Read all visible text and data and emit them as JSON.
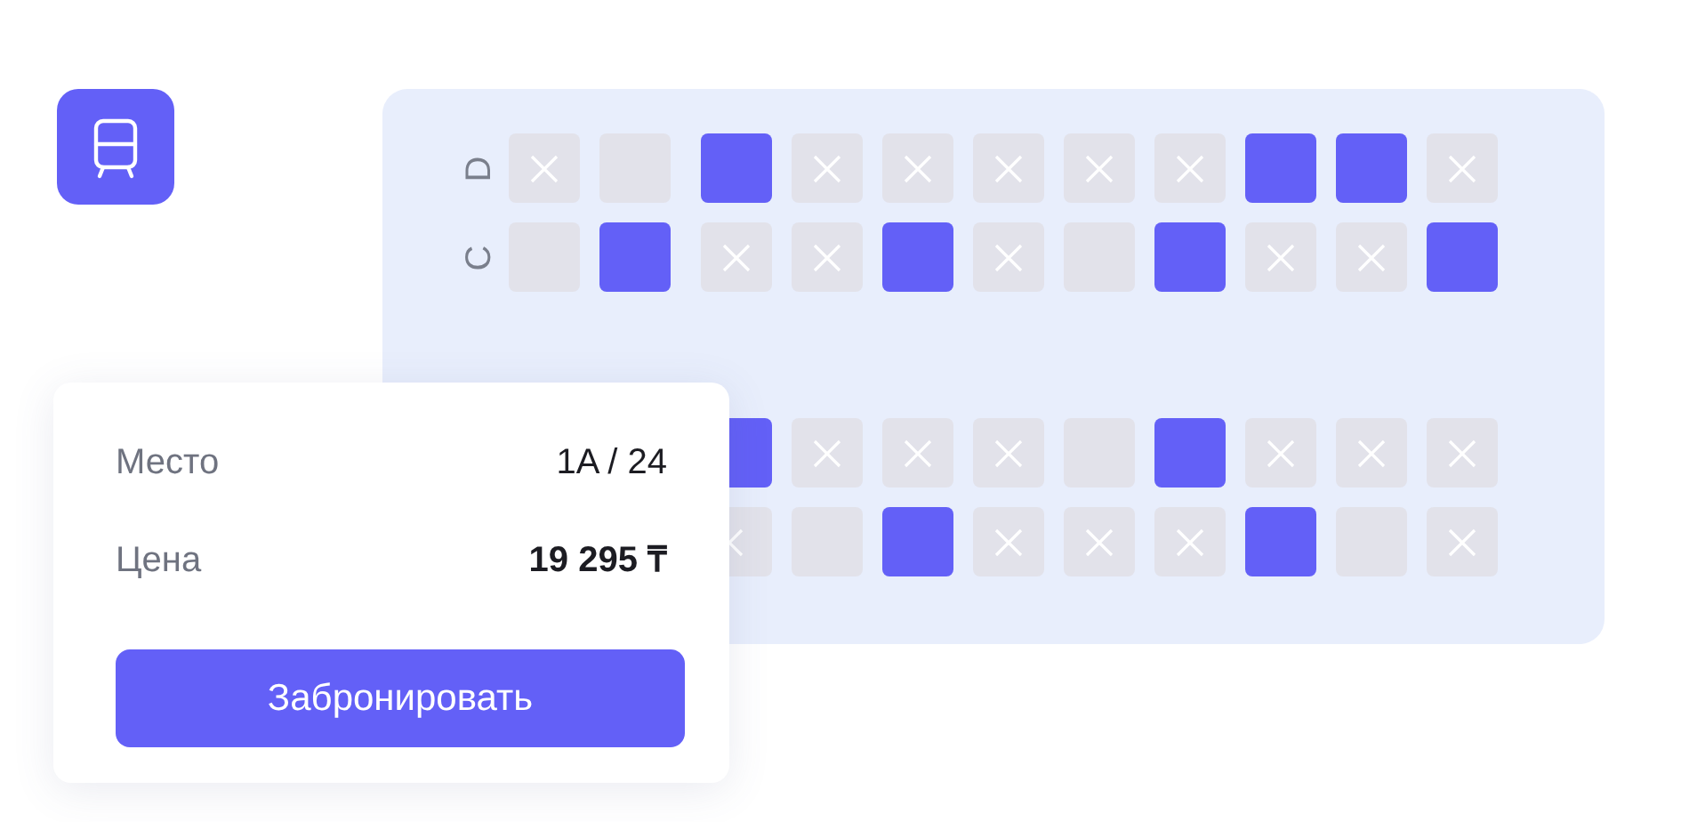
{
  "seat_map": {
    "rows": [
      {
        "label": "D",
        "seats": [
          {
            "kind": "occupied"
          },
          {
            "kind": "blocked"
          },
          {
            "kind": "available"
          },
          {
            "kind": "occupied"
          },
          {
            "kind": "occupied"
          },
          {
            "kind": "occupied"
          },
          {
            "kind": "occupied"
          },
          {
            "kind": "occupied"
          },
          {
            "kind": "available"
          },
          {
            "kind": "available"
          },
          {
            "kind": "occupied"
          }
        ]
      },
      {
        "label": "C",
        "seats": [
          {
            "kind": "blocked"
          },
          {
            "kind": "available"
          },
          {
            "kind": "occupied"
          },
          {
            "kind": "occupied"
          },
          {
            "kind": "available"
          },
          {
            "kind": "occupied"
          },
          {
            "kind": "blocked"
          },
          {
            "kind": "available"
          },
          {
            "kind": "occupied"
          },
          {
            "kind": "occupied"
          },
          {
            "kind": "available"
          }
        ]
      }
    ],
    "lower_rows": [
      {
        "seats": [
          {
            "kind": "available"
          },
          {
            "kind": "occupied"
          },
          {
            "kind": "occupied"
          },
          {
            "kind": "occupied"
          },
          {
            "kind": "blocked"
          },
          {
            "kind": "available"
          },
          {
            "kind": "occupied"
          },
          {
            "kind": "occupied"
          },
          {
            "kind": "occupied"
          }
        ]
      },
      {
        "seats": [
          {
            "kind": "occupied"
          },
          {
            "kind": "blocked"
          },
          {
            "kind": "available"
          },
          {
            "kind": "occupied"
          },
          {
            "kind": "occupied"
          },
          {
            "kind": "occupied"
          },
          {
            "kind": "available"
          },
          {
            "kind": "blocked"
          },
          {
            "kind": "occupied"
          }
        ]
      }
    ]
  },
  "booking_card": {
    "fields": [
      {
        "label": "Место",
        "value": "1A / 24",
        "bold": false
      },
      {
        "label": "Цена",
        "value": "19 295 ₸",
        "bold": true
      }
    ],
    "button": "Забронировать"
  }
}
